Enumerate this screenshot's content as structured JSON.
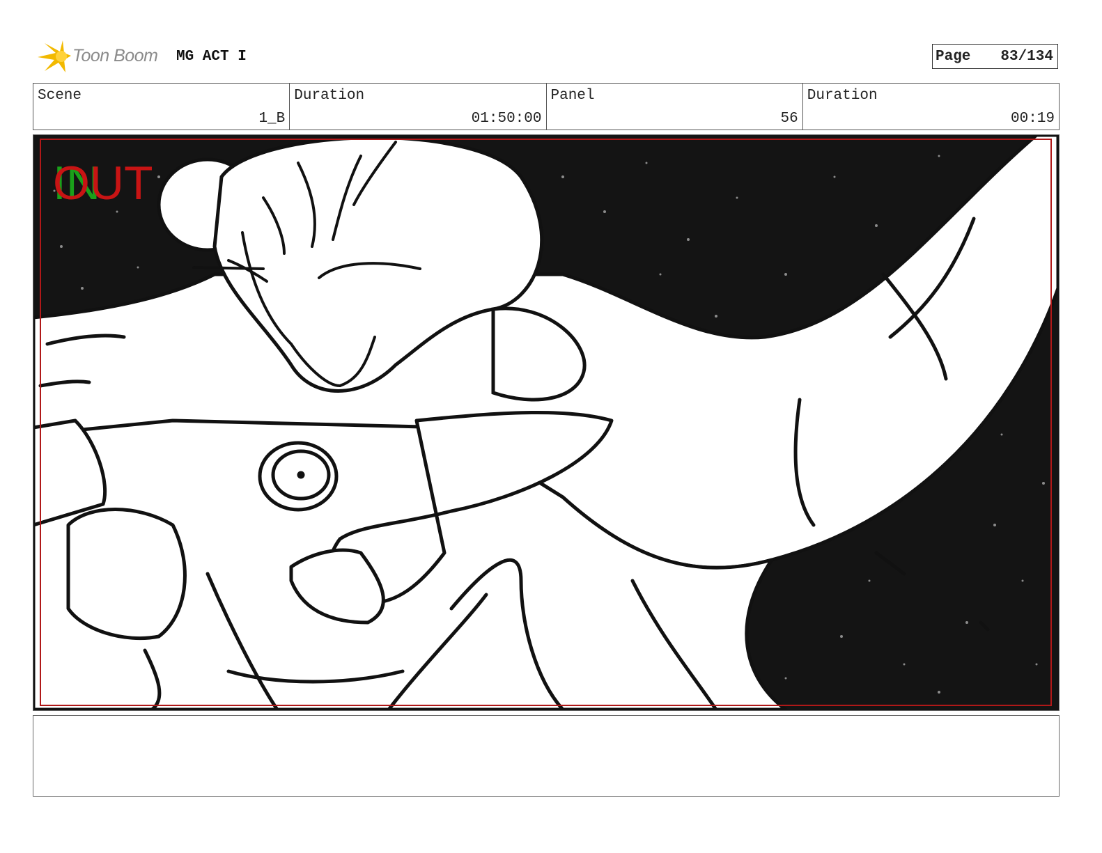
{
  "header": {
    "logo_text": "Toon Boom",
    "project_title": "MG ACT I",
    "page_label": "Page",
    "page_value": "83/134"
  },
  "info": {
    "scene_label": "Scene",
    "scene_value": "1_B",
    "scene_duration_label": "Duration",
    "scene_duration_value": "01:50:00",
    "panel_label": "Panel",
    "panel_value": "56",
    "panel_duration_label": "Duration",
    "panel_duration_value": "00:19"
  },
  "panel": {
    "in_marker": "IN",
    "out_marker": "OUT",
    "safe_frame_color": "#b01818",
    "in_color": "#1aa01a",
    "out_color": "#c81414"
  },
  "notes": {
    "text": ""
  }
}
